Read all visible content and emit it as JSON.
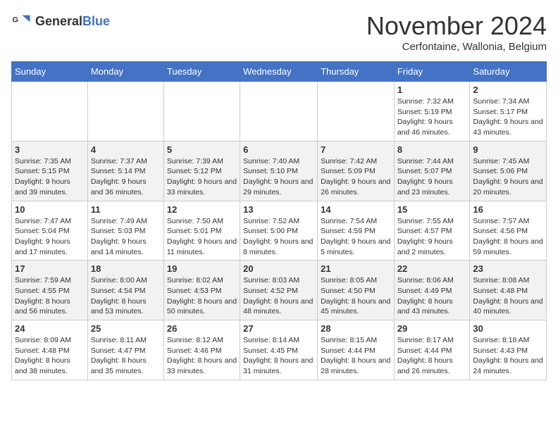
{
  "logo": {
    "general": "General",
    "blue": "Blue"
  },
  "title": "November 2024",
  "subtitle": "Cerfontaine, Wallonia, Belgium",
  "days_of_week": [
    "Sunday",
    "Monday",
    "Tuesday",
    "Wednesday",
    "Thursday",
    "Friday",
    "Saturday"
  ],
  "weeks": [
    [
      {
        "day": "",
        "info": ""
      },
      {
        "day": "",
        "info": ""
      },
      {
        "day": "",
        "info": ""
      },
      {
        "day": "",
        "info": ""
      },
      {
        "day": "",
        "info": ""
      },
      {
        "day": "1",
        "info": "Sunrise: 7:32 AM\nSunset: 5:19 PM\nDaylight: 9 hours and 46 minutes."
      },
      {
        "day": "2",
        "info": "Sunrise: 7:34 AM\nSunset: 5:17 PM\nDaylight: 9 hours and 43 minutes."
      }
    ],
    [
      {
        "day": "3",
        "info": "Sunrise: 7:35 AM\nSunset: 5:15 PM\nDaylight: 9 hours and 39 minutes."
      },
      {
        "day": "4",
        "info": "Sunrise: 7:37 AM\nSunset: 5:14 PM\nDaylight: 9 hours and 36 minutes."
      },
      {
        "day": "5",
        "info": "Sunrise: 7:39 AM\nSunset: 5:12 PM\nDaylight: 9 hours and 33 minutes."
      },
      {
        "day": "6",
        "info": "Sunrise: 7:40 AM\nSunset: 5:10 PM\nDaylight: 9 hours and 29 minutes."
      },
      {
        "day": "7",
        "info": "Sunrise: 7:42 AM\nSunset: 5:09 PM\nDaylight: 9 hours and 26 minutes."
      },
      {
        "day": "8",
        "info": "Sunrise: 7:44 AM\nSunset: 5:07 PM\nDaylight: 9 hours and 23 minutes."
      },
      {
        "day": "9",
        "info": "Sunrise: 7:45 AM\nSunset: 5:06 PM\nDaylight: 9 hours and 20 minutes."
      }
    ],
    [
      {
        "day": "10",
        "info": "Sunrise: 7:47 AM\nSunset: 5:04 PM\nDaylight: 9 hours and 17 minutes."
      },
      {
        "day": "11",
        "info": "Sunrise: 7:49 AM\nSunset: 5:03 PM\nDaylight: 9 hours and 14 minutes."
      },
      {
        "day": "12",
        "info": "Sunrise: 7:50 AM\nSunset: 5:01 PM\nDaylight: 9 hours and 11 minutes."
      },
      {
        "day": "13",
        "info": "Sunrise: 7:52 AM\nSunset: 5:00 PM\nDaylight: 9 hours and 8 minutes."
      },
      {
        "day": "14",
        "info": "Sunrise: 7:54 AM\nSunset: 4:59 PM\nDaylight: 9 hours and 5 minutes."
      },
      {
        "day": "15",
        "info": "Sunrise: 7:55 AM\nSunset: 4:57 PM\nDaylight: 9 hours and 2 minutes."
      },
      {
        "day": "16",
        "info": "Sunrise: 7:57 AM\nSunset: 4:56 PM\nDaylight: 8 hours and 59 minutes."
      }
    ],
    [
      {
        "day": "17",
        "info": "Sunrise: 7:59 AM\nSunset: 4:55 PM\nDaylight: 8 hours and 56 minutes."
      },
      {
        "day": "18",
        "info": "Sunrise: 8:00 AM\nSunset: 4:54 PM\nDaylight: 8 hours and 53 minutes."
      },
      {
        "day": "19",
        "info": "Sunrise: 8:02 AM\nSunset: 4:53 PM\nDaylight: 8 hours and 50 minutes."
      },
      {
        "day": "20",
        "info": "Sunrise: 8:03 AM\nSunset: 4:52 PM\nDaylight: 8 hours and 48 minutes."
      },
      {
        "day": "21",
        "info": "Sunrise: 8:05 AM\nSunset: 4:50 PM\nDaylight: 8 hours and 45 minutes."
      },
      {
        "day": "22",
        "info": "Sunrise: 8:06 AM\nSunset: 4:49 PM\nDaylight: 8 hours and 43 minutes."
      },
      {
        "day": "23",
        "info": "Sunrise: 8:08 AM\nSunset: 4:48 PM\nDaylight: 8 hours and 40 minutes."
      }
    ],
    [
      {
        "day": "24",
        "info": "Sunrise: 8:09 AM\nSunset: 4:48 PM\nDaylight: 8 hours and 38 minutes."
      },
      {
        "day": "25",
        "info": "Sunrise: 8:11 AM\nSunset: 4:47 PM\nDaylight: 8 hours and 35 minutes."
      },
      {
        "day": "26",
        "info": "Sunrise: 8:12 AM\nSunset: 4:46 PM\nDaylight: 8 hours and 33 minutes."
      },
      {
        "day": "27",
        "info": "Sunrise: 8:14 AM\nSunset: 4:45 PM\nDaylight: 8 hours and 31 minutes."
      },
      {
        "day": "28",
        "info": "Sunrise: 8:15 AM\nSunset: 4:44 PM\nDaylight: 8 hours and 28 minutes."
      },
      {
        "day": "29",
        "info": "Sunrise: 8:17 AM\nSunset: 4:44 PM\nDaylight: 8 hours and 26 minutes."
      },
      {
        "day": "30",
        "info": "Sunrise: 8:18 AM\nSunset: 4:43 PM\nDaylight: 8 hours and 24 minutes."
      }
    ]
  ]
}
